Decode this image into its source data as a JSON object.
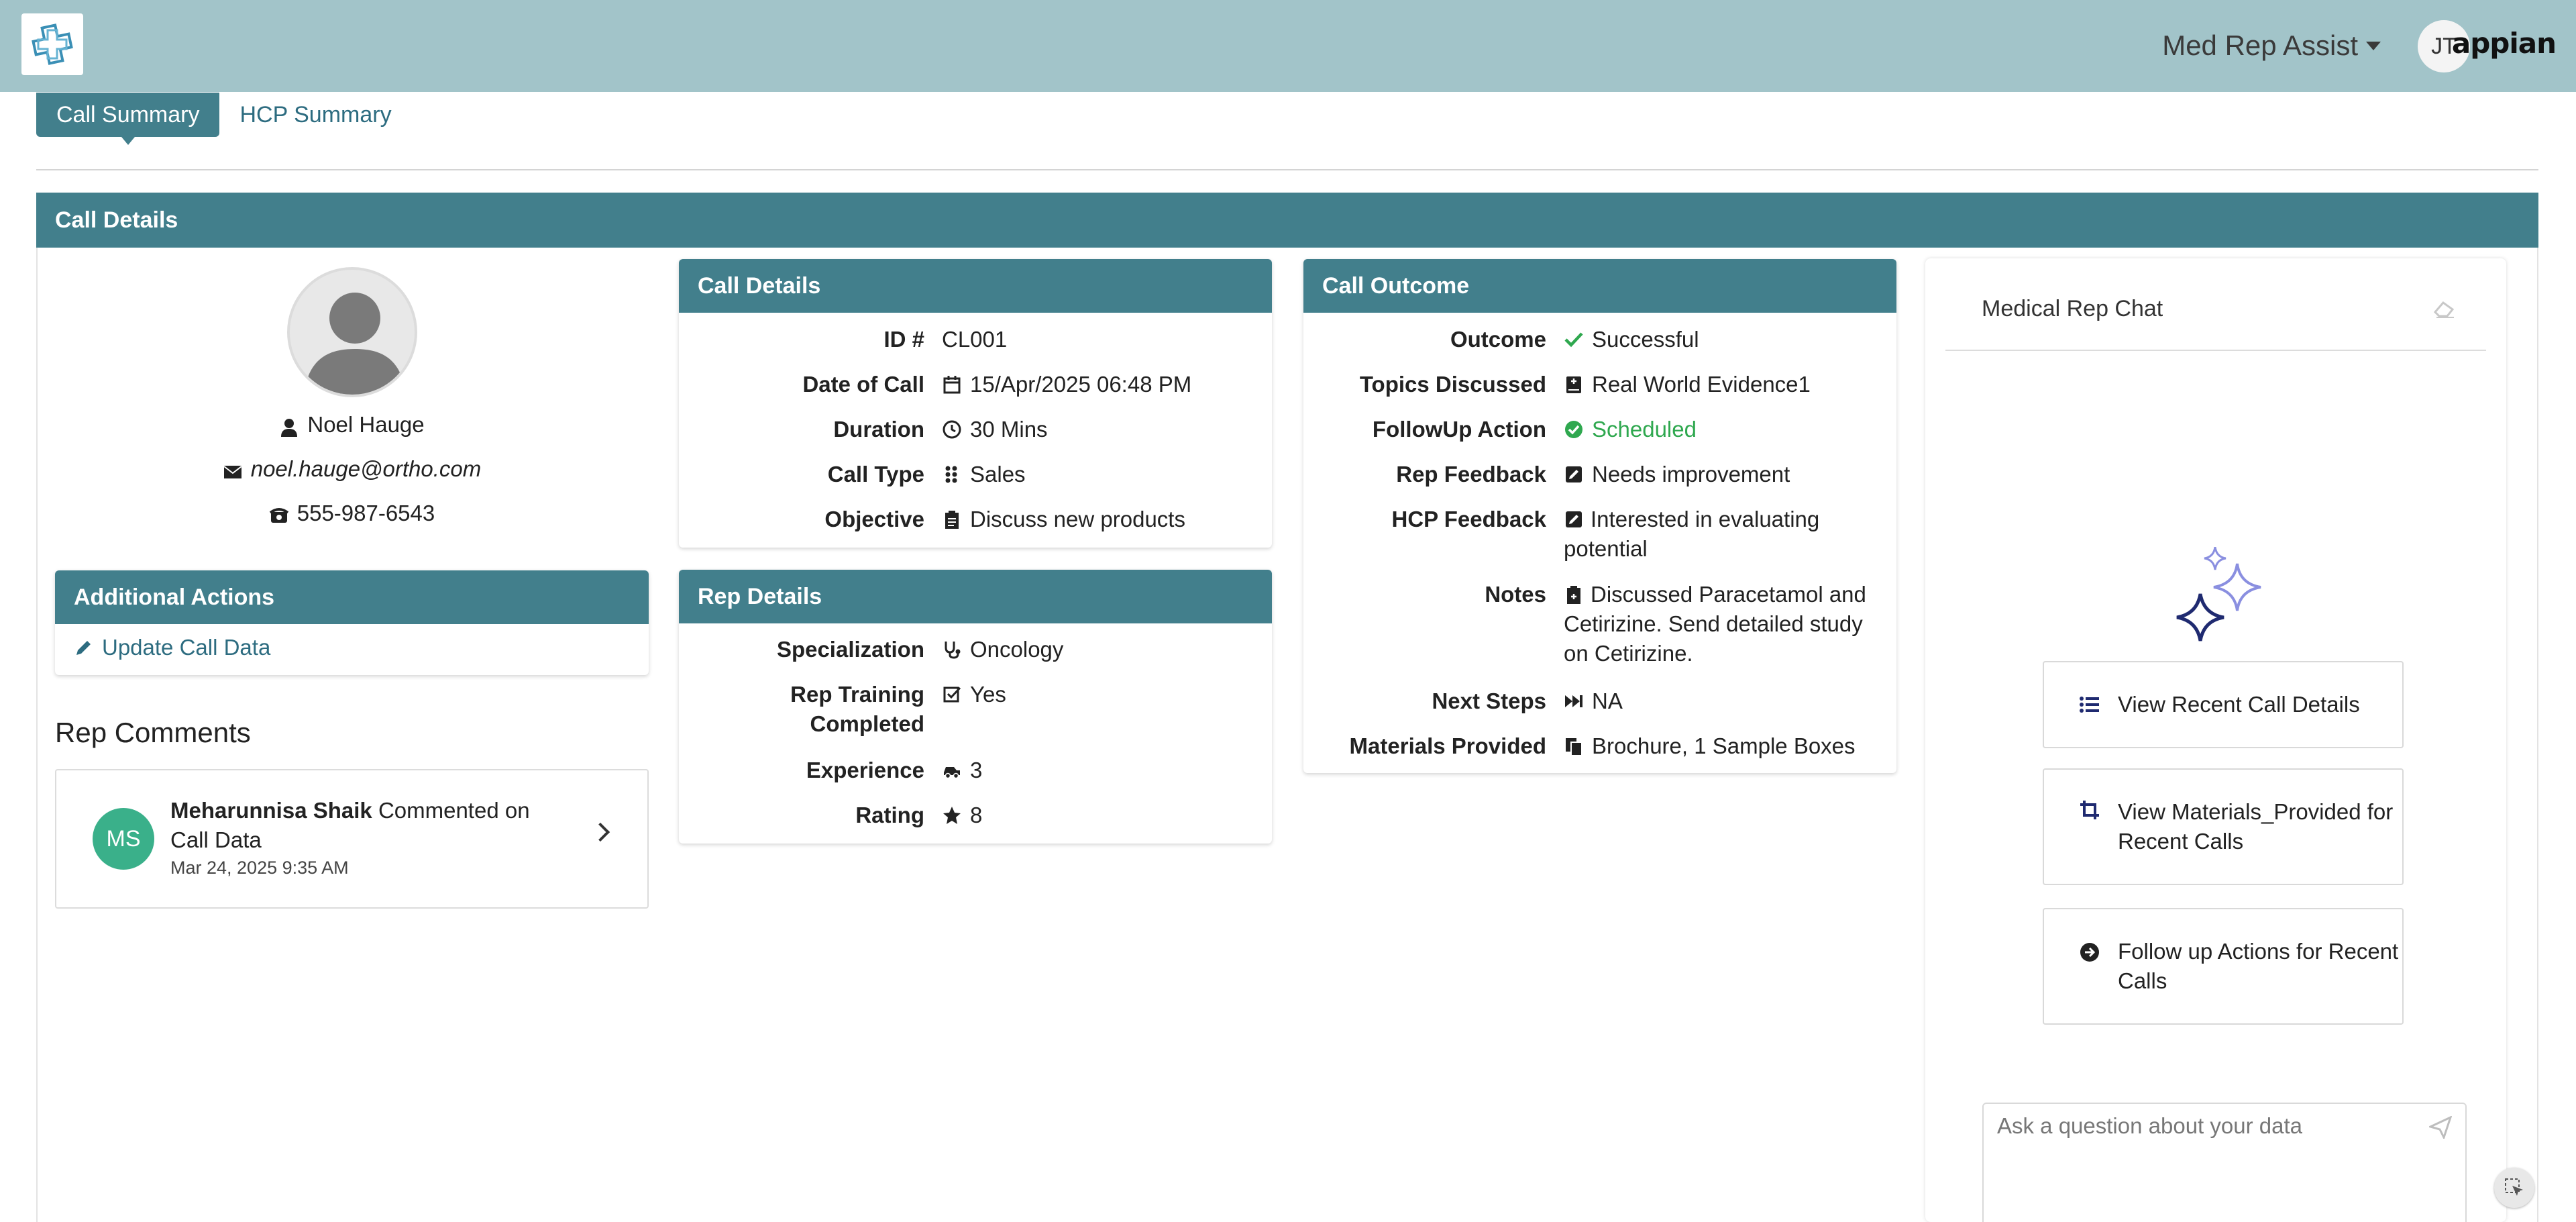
{
  "header": {
    "app_name": "Med Rep Assist",
    "user_initials": "JT",
    "brand": "appian",
    "logo_icon": "medical-cross-logo"
  },
  "tabs": [
    {
      "label": "Call Summary",
      "active": true
    },
    {
      "label": "HCP Summary",
      "active": false
    }
  ],
  "main": {
    "title": "Call Details"
  },
  "profile": {
    "name": "Noel Hauge",
    "email": "noel.hauge@ortho.com",
    "phone": "555-987-6543"
  },
  "additional_actions": {
    "title": "Additional Actions",
    "update_link": "Update Call Data"
  },
  "call_details": {
    "title": "Call Details",
    "rows": [
      {
        "label": "ID #",
        "value": "CL001",
        "icon": "none"
      },
      {
        "label": "Date of Call",
        "value": "15/Apr/2025 06:48 PM",
        "icon": "calendar-icon"
      },
      {
        "label": "Duration",
        "value": "30 Mins",
        "icon": "clock-icon"
      },
      {
        "label": "Call Type",
        "value": "Sales",
        "icon": "grid-icon"
      },
      {
        "label": "Objective",
        "value": "Discuss new products",
        "icon": "clipboard-icon"
      }
    ]
  },
  "rep_details": {
    "title": "Rep Details",
    "rows": [
      {
        "label": "Specialization",
        "value": "Oncology",
        "icon": "stethoscope-icon"
      },
      {
        "label": "Rep Training Completed",
        "value": "Yes",
        "icon": "check-square-icon"
      },
      {
        "label": "Experience",
        "value": "3",
        "icon": "car-icon"
      },
      {
        "label": "Rating",
        "value": "8",
        "icon": "star-icon"
      }
    ]
  },
  "call_outcome": {
    "title": "Call Outcome",
    "rows": [
      {
        "label": "Outcome",
        "value": "Successful",
        "icon": "check-icon"
      },
      {
        "label": "Topics Discussed",
        "value": "Real World Evidence1",
        "icon": "book-icon"
      },
      {
        "label": "FollowUp Action",
        "value": "Scheduled",
        "icon": "check-circle-icon"
      },
      {
        "label": "Rep Feedback",
        "value": "Needs improvement",
        "icon": "edit-icon"
      },
      {
        "label": "HCP Feedback",
        "value": "Interested in evaluating potential",
        "icon": "edit-icon"
      },
      {
        "label": "Notes",
        "value": "Discussed Paracetamol and Cetirizine. Send detailed study on Cetirizine.",
        "icon": "clipboard-plus-icon"
      },
      {
        "label": "Next Steps",
        "value": "NA",
        "icon": "fast-forward-icon"
      },
      {
        "label": "Materials Provided",
        "value": "Brochure, 1 Sample Boxes",
        "icon": "copy-icon"
      }
    ],
    "success_color": "#2fa84f"
  },
  "rep_comments": {
    "title": "Rep Comments",
    "author": "Meharunnisa Shaik",
    "author_initials": "MS",
    "action": "Commented on Call Data",
    "date": "Mar 24, 2025 9:35 AM"
  },
  "chat": {
    "title": "Medical Rep Chat",
    "buttons": [
      "View Recent Call Details",
      "View Materials_Provided for Recent Calls",
      "Follow up Actions for Recent Calls"
    ],
    "input_placeholder": "Ask a question about your data"
  },
  "colors": {
    "header_bg": "#a2c4c9",
    "accent": "#427f8c",
    "link": "#2d6c80"
  }
}
